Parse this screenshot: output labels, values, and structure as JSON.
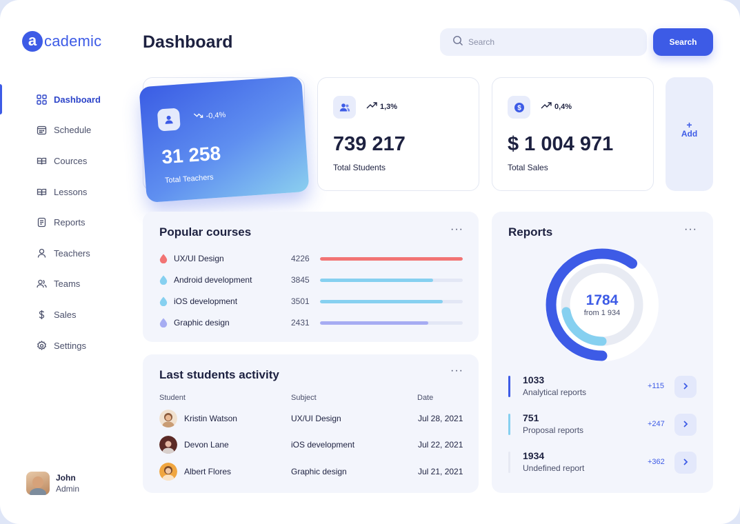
{
  "brand": {
    "logo_letter": "a",
    "logo_text": "cademic",
    "accent": "#3d5be6"
  },
  "sidebar": {
    "items": [
      {
        "label": "Dashboard",
        "icon": "grid-icon",
        "active": true
      },
      {
        "label": "Schedule",
        "icon": "calendar-icon",
        "active": false
      },
      {
        "label": "Cources",
        "icon": "book-icon",
        "active": false
      },
      {
        "label": "Lessons",
        "icon": "book-open-icon",
        "active": false
      },
      {
        "label": "Reports",
        "icon": "document-icon",
        "active": false
      },
      {
        "label": "Teachers",
        "icon": "user-icon",
        "active": false
      },
      {
        "label": "Teams",
        "icon": "users-icon",
        "active": false
      },
      {
        "label": "Sales",
        "icon": "dollar-icon",
        "active": false
      },
      {
        "label": "Settings",
        "icon": "gear-icon",
        "active": false
      }
    ],
    "user": {
      "name": "John",
      "role": "Admin"
    }
  },
  "header": {
    "title": "Dashboard",
    "search_placeholder": "Search",
    "search_button": "Search"
  },
  "stats": {
    "teachers": {
      "value": "31 258",
      "label": "Total Teachers",
      "delta": "-0,4%",
      "trend": "down"
    },
    "students": {
      "value": "739 217",
      "label": "Total Students",
      "delta": "1,3%",
      "trend": "up"
    },
    "sales": {
      "value": "$ 1 004 971",
      "label": "Total Sales",
      "delta": "0,4%",
      "trend": "up"
    },
    "add": {
      "plus": "+",
      "label": "Add"
    }
  },
  "popular_courses": {
    "title": "Popular courses",
    "menu": "···",
    "items": [
      {
        "name": "UX/UI Design",
        "count": "4226",
        "fill": 1.0,
        "color": "#f27474"
      },
      {
        "name": "Android development",
        "count": "3845",
        "fill": 0.79,
        "color": "#86d0f0"
      },
      {
        "name": "iOS development",
        "count": "3501",
        "fill": 0.86,
        "color": "#86d0f0"
      },
      {
        "name": "Graphic design",
        "count": "2431",
        "fill": 0.76,
        "color": "#a6acf2"
      }
    ]
  },
  "activity": {
    "title": "Last students activity",
    "menu": "···",
    "columns": {
      "student": "Student",
      "subject": "Subject",
      "date": "Date"
    },
    "rows": [
      {
        "student": "Kristin Watson",
        "subject": "UX/UI Design",
        "date": "Jul 28, 2021",
        "avatar_color": "#c99c74"
      },
      {
        "student": "Devon Lane",
        "subject": "iOS development",
        "date": "Jul 22, 2021",
        "avatar_color": "#9c4a3a"
      },
      {
        "student": "Albert Flores",
        "subject": "Graphic design",
        "date": "Jul 21, 2021",
        "avatar_color": "#e8a24a"
      }
    ]
  },
  "reports": {
    "title": "Reports",
    "menu": "···",
    "total": "1784",
    "sub": "from 1 934",
    "ring_outer_fraction": 0.6,
    "ring_inner_fraction": 0.22,
    "items": [
      {
        "num": "1033",
        "name": "Analytical reports",
        "delta": "+115",
        "color": "#3d5be6"
      },
      {
        "num": "751",
        "name": "Proposal reports",
        "delta": "+247",
        "color": "#86d0f0"
      },
      {
        "num": "1934",
        "name": "Undefined report",
        "delta": "+362",
        "color": "#e6e9f3"
      }
    ]
  }
}
